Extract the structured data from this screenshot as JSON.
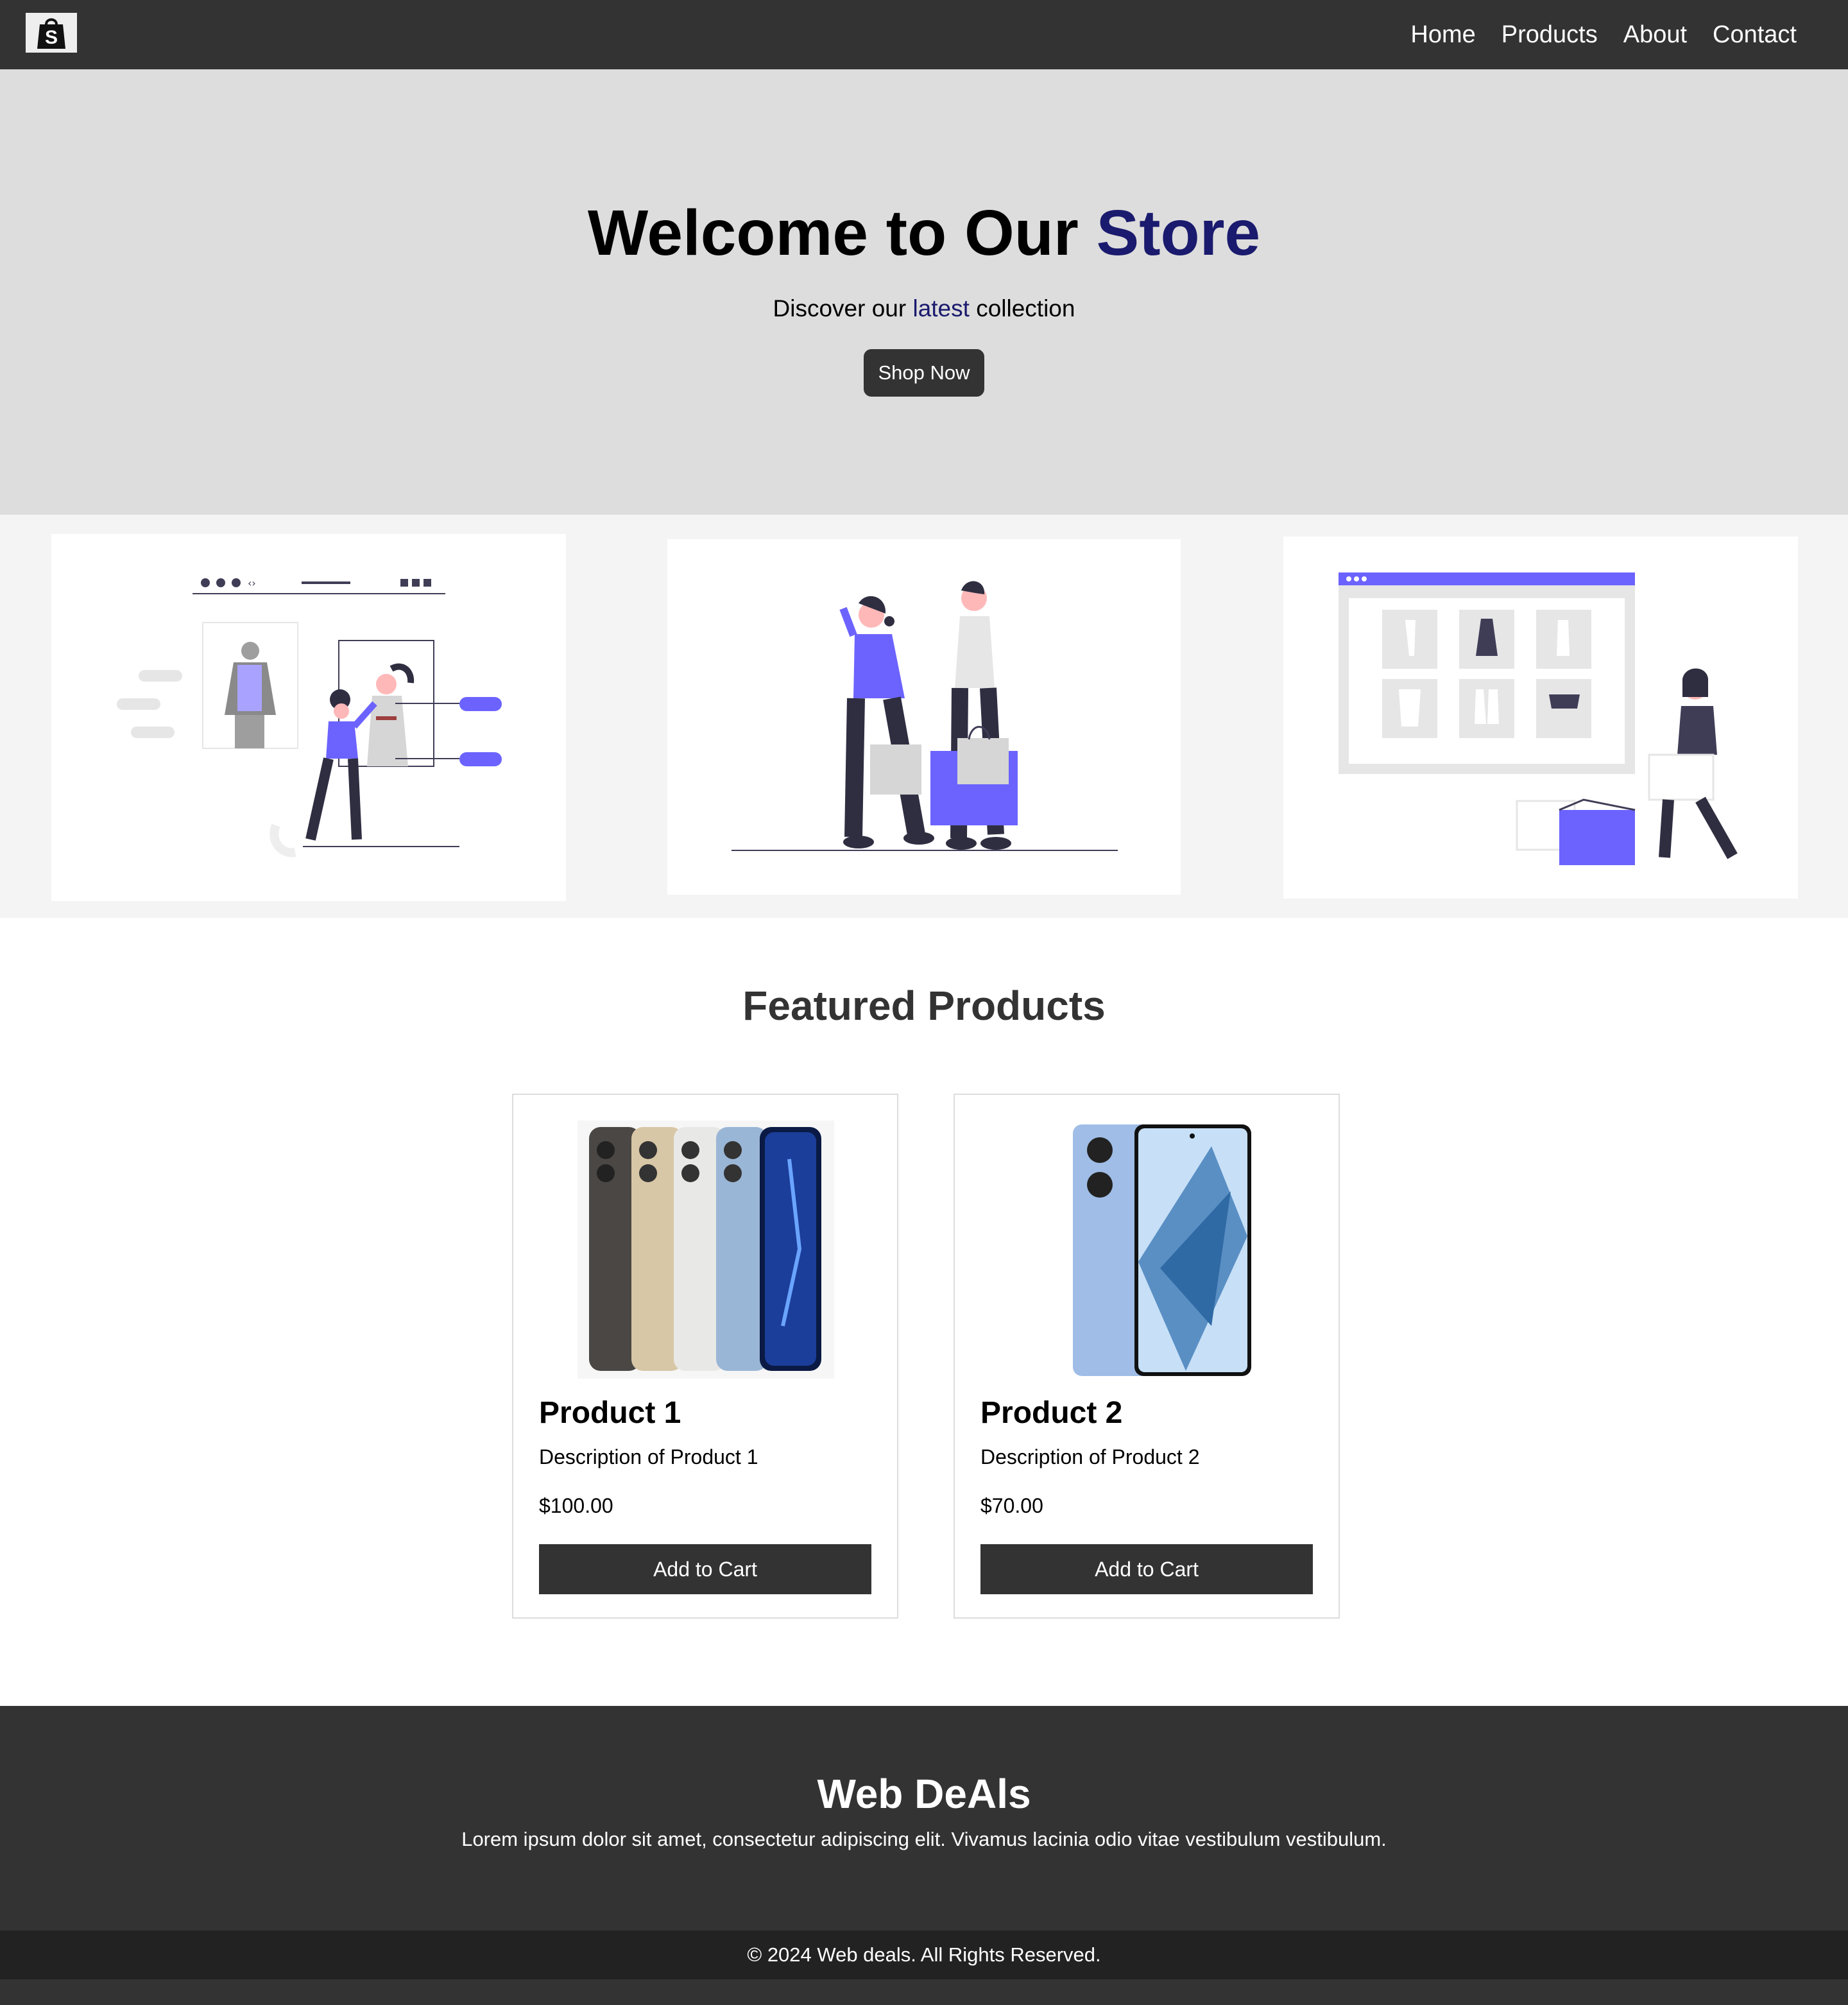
{
  "nav": {
    "logo_icon": "shopping-bag-icon",
    "links": [
      "Home",
      "Products",
      "About",
      "Contact"
    ]
  },
  "hero": {
    "title_prefix": "Welcome to Our ",
    "title_accent": "Store",
    "subtitle_prefix": "Discover our ",
    "subtitle_accent": "latest",
    "subtitle_suffix": " collection",
    "button_label": "Shop Now",
    "accent_color": "#1a1a6e"
  },
  "illustrations": [
    {
      "name": "online-fitting-illustration"
    },
    {
      "name": "shopping-couple-illustration"
    },
    {
      "name": "online-store-delivery-illustration"
    }
  ],
  "featured": {
    "title": "Featured Products",
    "products": [
      {
        "name": "Product 1",
        "description": "Description of Product 1",
        "price": "$100.00",
        "button": "Add to Cart"
      },
      {
        "name": "Product 2",
        "description": "Description of Product 2",
        "price": "$70.00",
        "button": "Add to Cart"
      }
    ]
  },
  "footer": {
    "title": "Web DeAls",
    "text": "Lorem ipsum dolor sit amet, consectetur adipiscing elit. Vivamus lacinia odio vitae vestibulum vestibulum.",
    "copyright": "© 2024 Web deals. All Rights Reserved."
  },
  "colors": {
    "dark": "#333333",
    "hero_bg": "#dddddd",
    "purple": "#6c63ff"
  }
}
